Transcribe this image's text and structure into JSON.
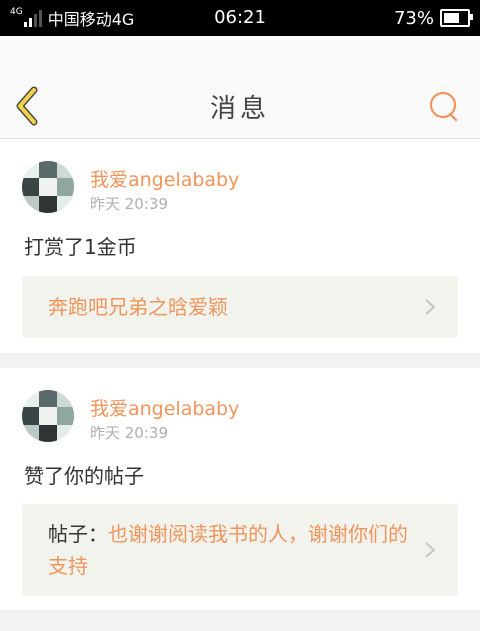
{
  "status_bar": {
    "network": "4G",
    "carrier": "中国移动4G",
    "time": "06:21",
    "battery": "73%",
    "battery_level": 0.73
  },
  "header": {
    "title": "消息",
    "back_icon": "chevron-left-icon",
    "search_icon": "search-icon"
  },
  "messages": [
    {
      "username": "我爱angelababy",
      "time": "昨天 20:39",
      "action": "打赏了1金币",
      "ref_prefix": "",
      "ref_text": "奔跑吧兄弟之晗爱颖"
    },
    {
      "username": "我爱angelababy",
      "time": "昨天 20:39",
      "action": "赞了你的帖子",
      "ref_prefix": "帖子：",
      "ref_text": "也谢谢阅读我书的人，谢谢你们的支持"
    }
  ],
  "colors": {
    "accent": "#f0955b",
    "back_icon": "#f2d24a"
  }
}
